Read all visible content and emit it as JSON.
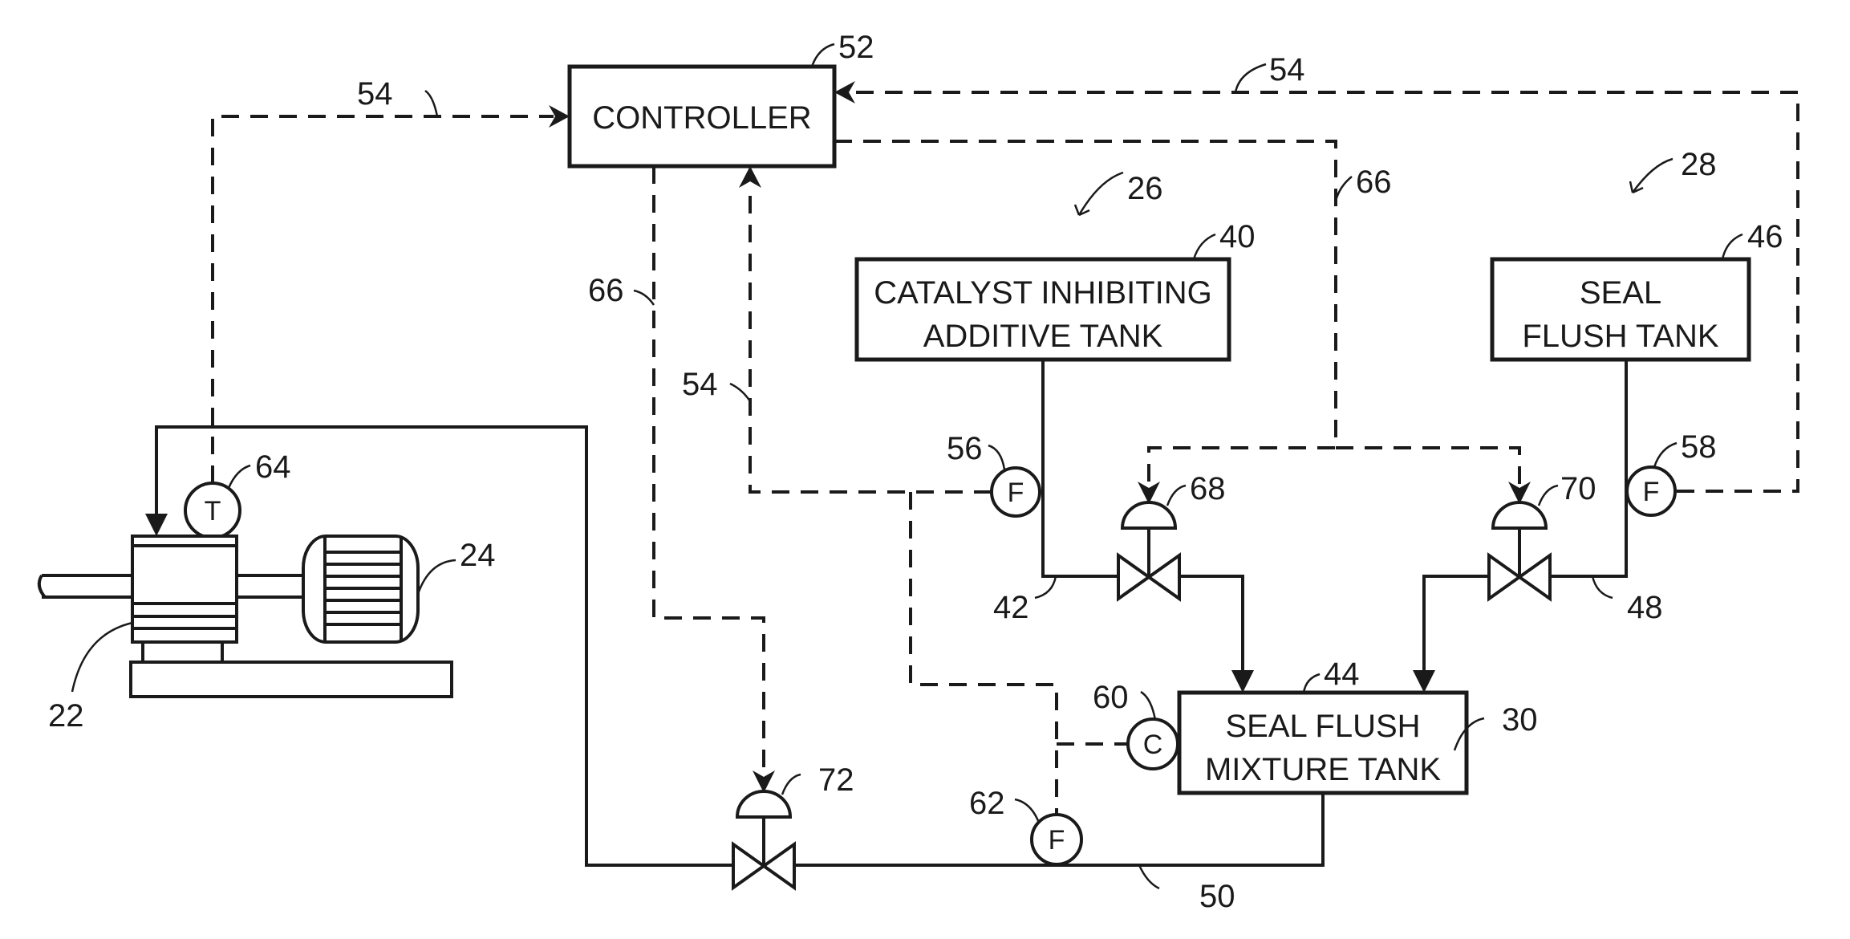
{
  "figure": {
    "type": "process-flow-schematic",
    "boxes": {
      "controller": "CONTROLLER",
      "catalyst_tank": [
        "CATALYST INHIBITING",
        "ADDITIVE TANK"
      ],
      "seal_flush_tank": [
        "SEAL",
        "FLUSH TANK"
      ],
      "mixture_tank": [
        "SEAL FLUSH",
        "MIXTURE TANK"
      ]
    },
    "instruments": {
      "temp_sensor": "T",
      "flow_sensor_catalyst": "F",
      "flow_sensor_seal": "F",
      "concentration_sensor": "C",
      "flow_sensor_outlet": "F"
    },
    "reference_numerals": {
      "pump": "22",
      "motor": "24",
      "catalyst_subsystem": "26",
      "seal_subsystem": "28",
      "mixture_tank": "30",
      "catalyst_tank": "40",
      "catalyst_line": "42",
      "mixture_tank_top": "44",
      "seal_flush_tank": "46",
      "seal_line": "48",
      "outlet_line": "50",
      "controller": "52",
      "signal_top": "54",
      "signal_left": "54",
      "signal_mid": "54",
      "flow_sensor_catalyst": "56",
      "flow_sensor_seal": "58",
      "concentration_sensor": "60",
      "flow_sensor_outlet": "62",
      "temp_sensor": "64",
      "control_line_right": "66",
      "control_line_left": "66",
      "valve_catalyst": "68",
      "valve_seal": "70",
      "valve_outlet": "72"
    }
  }
}
